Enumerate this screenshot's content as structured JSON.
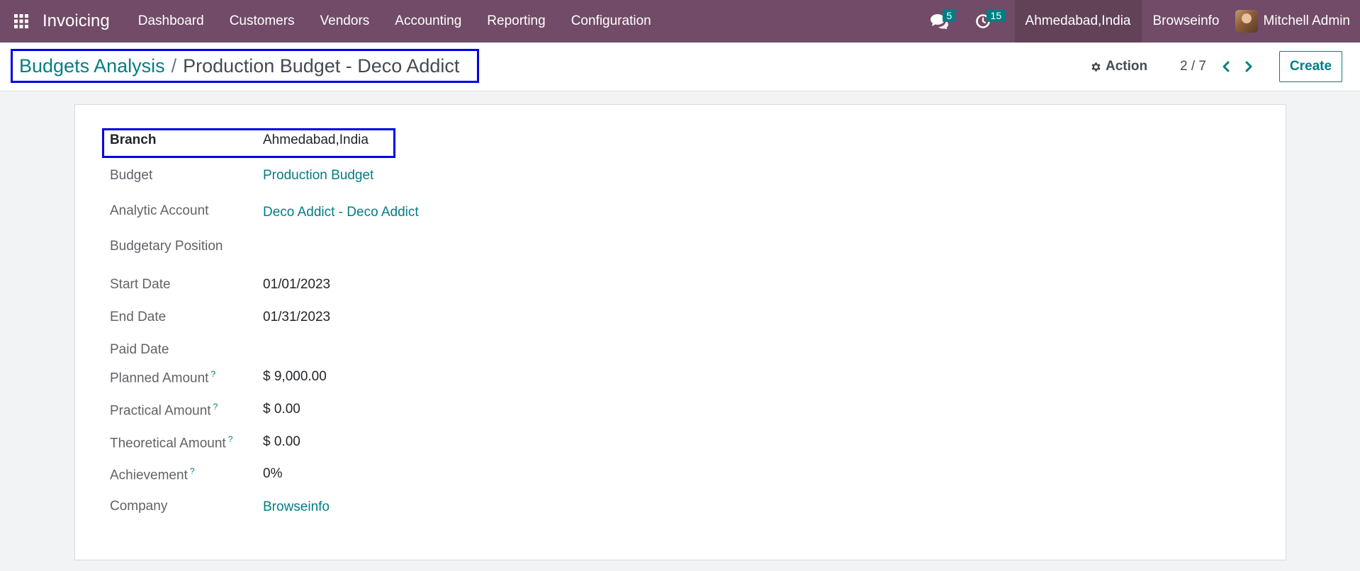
{
  "navbar": {
    "app_name": "Invoicing",
    "menu": [
      "Dashboard",
      "Customers",
      "Vendors",
      "Accounting",
      "Reporting",
      "Configuration"
    ],
    "messages_count": "5",
    "activities_count": "15",
    "branch": "Ahmedabad,India",
    "company": "Browseinfo",
    "user": "Mitchell Admin"
  },
  "control_panel": {
    "breadcrumb_parent": "Budgets Analysis",
    "breadcrumb_separator": "/",
    "breadcrumb_current": "Production Budget - Deco Addict",
    "action_label": "Action",
    "pager": "2 / 7",
    "create_label": "Create"
  },
  "form": {
    "fields": [
      {
        "label": "Branch",
        "value": "Ahmedabad,India"
      },
      {
        "label": "Budget",
        "value": "Production Budget"
      },
      {
        "label": "Analytic Account",
        "value": "Deco Addict - Deco Addict"
      },
      {
        "label": "Budgetary Position",
        "value": ""
      },
      {
        "label": "Start Date",
        "value": "01/01/2023"
      },
      {
        "label": "End Date",
        "value": "01/31/2023"
      },
      {
        "label": "Paid Date",
        "value": ""
      },
      {
        "label": "Planned Amount",
        "help": "?",
        "value": "$ 9,000.00"
      },
      {
        "label": "Practical Amount",
        "help": "?",
        "value": "$ 0.00"
      },
      {
        "label": "Theoretical Amount",
        "help": "?",
        "value": "$ 0.00"
      },
      {
        "label": "Achievement",
        "help": "?",
        "value": "0%"
      },
      {
        "label": "Company",
        "value": "Browseinfo"
      }
    ]
  },
  "colors": {
    "navbar": "#714b67",
    "accent": "#017e84",
    "highlight_box": "#0000e6"
  },
  "icons": [
    "apps-grid-icon",
    "chat-icon",
    "clock-icon",
    "gear-icon",
    "chevron-left-icon",
    "chevron-right-icon"
  ]
}
